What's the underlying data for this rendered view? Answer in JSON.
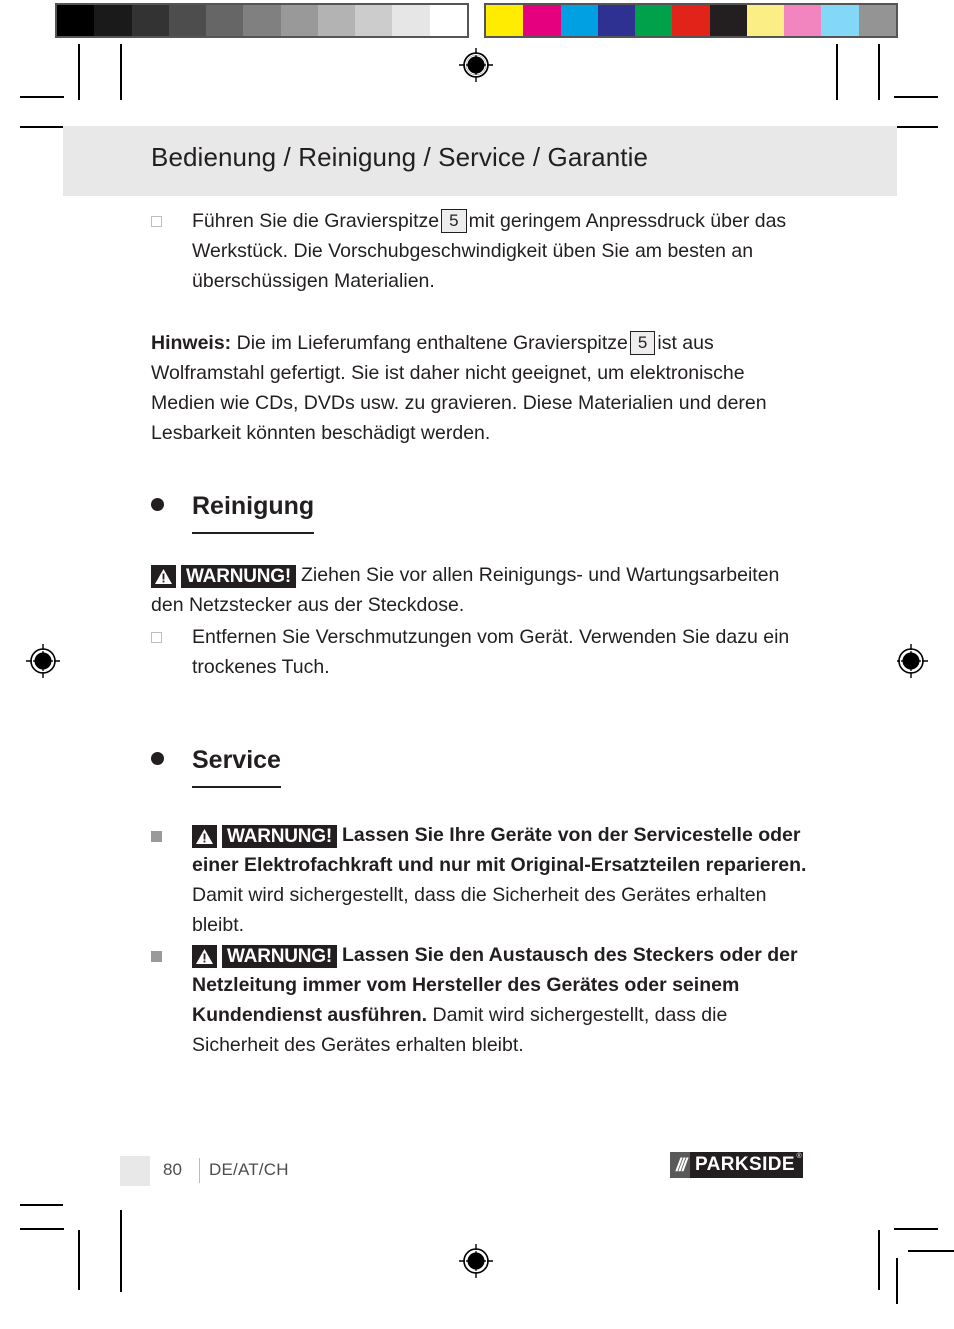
{
  "calibration": {
    "grays": [
      "#000000",
      "#1a1a1a",
      "#333333",
      "#4d4d4d",
      "#666666",
      "#808080",
      "#999999",
      "#b3b3b3",
      "#cccccc",
      "#e6e6e6",
      "#ffffff"
    ],
    "colors": [
      "#ffec00",
      "#e5007d",
      "#00a0e3",
      "#2e3192",
      "#00a14b",
      "#e2231a",
      "#231f20",
      "#fbee84",
      "#f284c0",
      "#84d8f7",
      "#949494"
    ]
  },
  "header": {
    "title": "Bedienung / Reinigung / Service / Garantie"
  },
  "content": {
    "intro_item": {
      "text_before_ref": "Führen Sie die Gravierspitze",
      "ref": "5",
      "text_after_ref": "mit geringem Anpressdruck über das Werkstück. Die Vorschubgeschwindigkeit üben Sie am besten an überschüssigen Materialien."
    },
    "note": {
      "label": "Hinweis:",
      "text_before_ref": "Die im Lieferumfang enthaltene Gravierspitze",
      "ref": "5",
      "text_after_ref": "ist aus Wolframstahl gefertigt. Sie ist daher nicht geeignet, um elektronische Medien wie CDs, DVDs usw. zu gravieren. Diese Materialien und deren Lesbarkeit könnten beschädigt werden."
    },
    "cleaning": {
      "heading": "Reinigung",
      "warning_label": "WARNUNG!",
      "warning_text": "Ziehen Sie vor allen Reinigungs- und Wartungsarbeiten den Netzstecker aus der Steckdose.",
      "item": "Entfernen Sie Verschmutzungen vom Gerät. Verwenden Sie dazu ein trockenes Tuch."
    },
    "service": {
      "heading": "Service",
      "items": [
        {
          "warning_label": "WARNUNG!",
          "bold_text": "Lassen Sie Ihre Geräte von der Servicestelle oder einer Elektrofachkraft und nur mit Original-Ersatzteilen reparieren.",
          "normal_text": "Damit wird sichergestellt, dass die Sicherheit des Gerätes erhalten bleibt."
        },
        {
          "warning_label": "WARNUNG!",
          "bold_text": "Lassen Sie den Austausch des Steckers oder der Netzleitung immer vom Hersteller des Gerätes oder seinem Kundendienst ausführen.",
          "normal_text": "Damit wird sichergestellt, dass die Sicherheit des Gerätes erhalten bleibt."
        }
      ]
    }
  },
  "footer": {
    "page_number": "80",
    "locale": "DE/AT/CH",
    "brand_slashes": "///",
    "brand_name": "PARKSIDE",
    "brand_reg": "®"
  }
}
